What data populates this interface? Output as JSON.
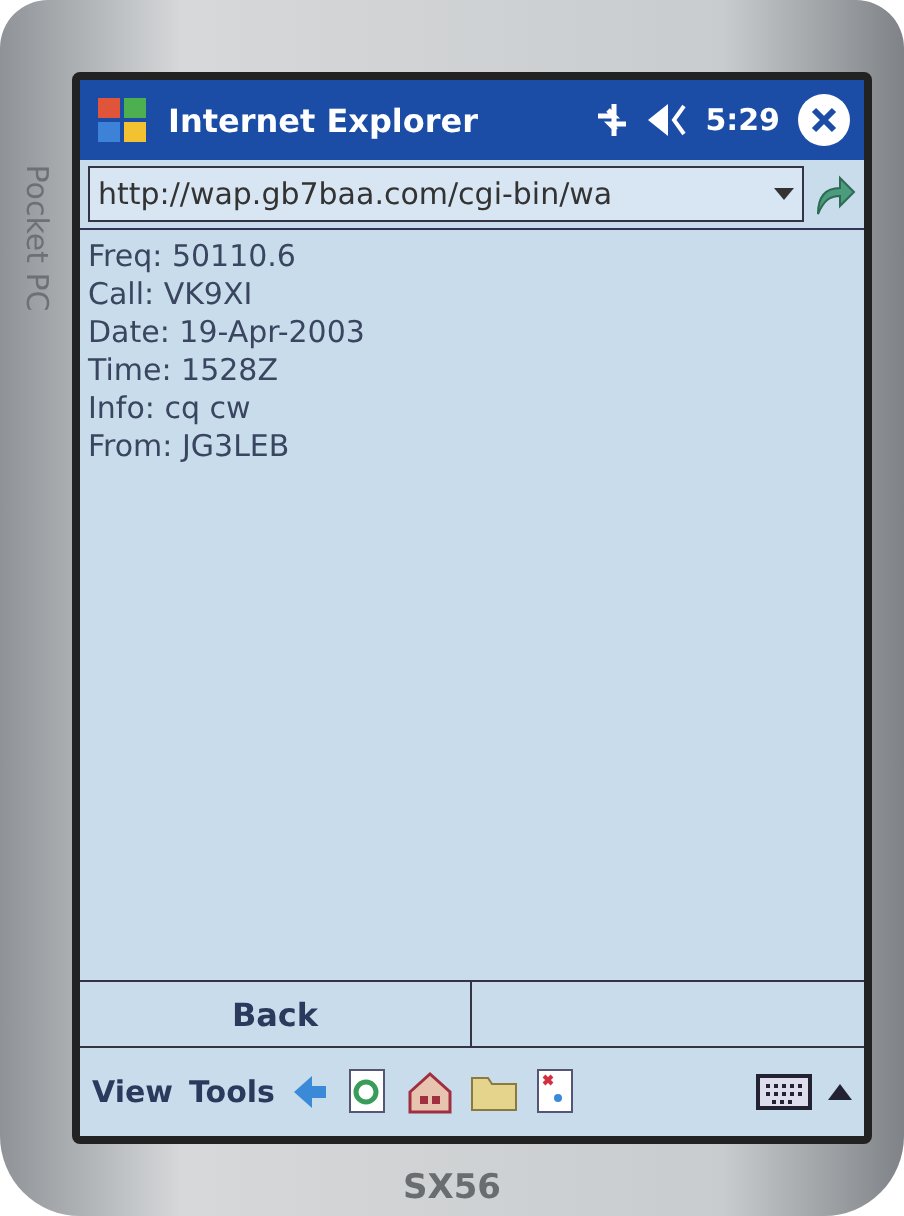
{
  "device": {
    "side_label": "Pocket PC",
    "model_label": "SX56"
  },
  "title_bar": {
    "title": "Internet Explorer",
    "time": "5:29"
  },
  "address_bar": {
    "value": "http://wap.gb7baa.com/cgi-bin/wa"
  },
  "content": {
    "lines": [
      "Freq: 50110.6",
      "Call: VK9XI",
      "Date: 19-Apr-2003",
      "Time: 1528Z",
      "Info: cq cw",
      "From: JG3LEB"
    ]
  },
  "softkeys": [
    "Back"
  ],
  "menu_bar": {
    "menus": [
      "View",
      "Tools"
    ]
  }
}
